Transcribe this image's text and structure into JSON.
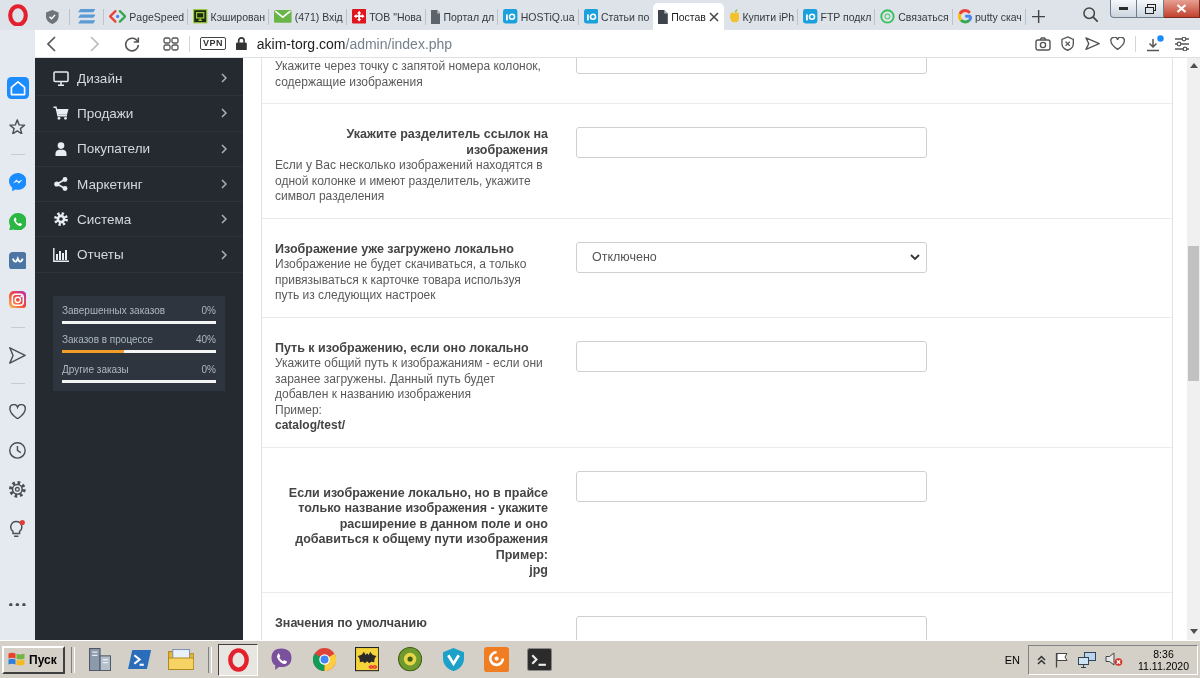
{
  "browser": {
    "tabs": [
      {
        "kind": "pinned",
        "selected": false
      },
      {
        "kind": "pinned",
        "selected": false
      },
      {
        "kind": "page",
        "title": "PageSpeed",
        "selected": false
      },
      {
        "kind": "page",
        "title": "Кэширован",
        "selected": false
      },
      {
        "kind": "page",
        "title": "(471) Вхід",
        "selected": false
      },
      {
        "kind": "page",
        "title": "ТОВ \"Нова",
        "selected": false
      },
      {
        "kind": "page",
        "title": "Портал дл",
        "selected": false
      },
      {
        "kind": "page",
        "title": "HOSTiQ.ua",
        "selected": false
      },
      {
        "kind": "page",
        "title": "Статьи по",
        "selected": false
      },
      {
        "kind": "page",
        "title": "Постав",
        "selected": true
      },
      {
        "kind": "page",
        "title": "Купити iPh",
        "selected": false
      },
      {
        "kind": "page",
        "title": "FTP подкл",
        "selected": false
      },
      {
        "kind": "page",
        "title": "Связаться",
        "selected": false
      },
      {
        "kind": "page",
        "title": "putty скач",
        "selected": false
      }
    ],
    "vpn_badge": "VPN",
    "address": {
      "host": "akim-torg.com",
      "path": "/admin/index.php"
    }
  },
  "opera_sidebar": {
    "items": [
      {
        "kind": "button",
        "selected": true
      },
      {
        "kind": "button",
        "selected": false
      },
      {
        "kind": "divider"
      },
      {
        "kind": "button",
        "selected": false
      },
      {
        "kind": "button",
        "selected": false
      },
      {
        "kind": "button",
        "selected": false
      },
      {
        "kind": "button",
        "selected": false
      },
      {
        "kind": "divider"
      },
      {
        "kind": "button",
        "selected": false
      },
      {
        "kind": "divider"
      },
      {
        "kind": "button",
        "selected": false
      },
      {
        "kind": "button",
        "selected": false
      },
      {
        "kind": "button",
        "selected": false
      },
      {
        "kind": "button",
        "selected": false
      }
    ]
  },
  "admin_menu": {
    "items": [
      {
        "label": "Дизайн"
      },
      {
        "label": "Продажи"
      },
      {
        "label": "Покупатели"
      },
      {
        "label": "Маркетинг"
      },
      {
        "label": "Система"
      },
      {
        "label": "Отчеты"
      }
    ]
  },
  "order_stats": {
    "rows": [
      {
        "label": "Завершенных заказов",
        "reading": "0%"
      },
      {
        "label": "Заказов в процессе",
        "reading": "40%",
        "level": 0.4
      },
      {
        "label": "Другие заказы",
        "reading": "0%"
      }
    ]
  },
  "form": {
    "rows": [
      {
        "kind": "left",
        "description": "Укажите через точку с запятой номера колонок, содержащие изображения",
        "control": {
          "kind": "input"
        }
      },
      {
        "kind": "right",
        "label": "Укажите разделитель ссылок на изображения",
        "description": "Если у Вас несколько изображений находятся в одной колонке и имеют разделитель, укажите символ разделения",
        "control": {
          "kind": "input"
        }
      },
      {
        "kind": "left",
        "label": "Изображение уже загружено локально",
        "description": "Изображение не будет скачиваться, а только привязываться к карточке товара используя путь из следующих настроек",
        "control": {
          "kind": "select",
          "value": "Отключено"
        }
      },
      {
        "kind": "left",
        "label": "Путь к изображению, если оно локально",
        "description": "Укажите общий путь к изображаниям - если они заранее загружены. Данный путь будет добавлен к названию изображения",
        "example_label": "Пример:",
        "example": "catalog/test/",
        "control": {
          "kind": "input"
        }
      },
      {
        "kind": "right-block",
        "label": "Если изображение локально, но в прайсе только название изображения - укажите расширение в данном поле и оно добавиться к общему пути изображения",
        "example_label": "Пример:",
        "example": "jpg",
        "control": {
          "kind": "input"
        }
      },
      {
        "kind": "left",
        "label": "Значения по умолчанию",
        "control": {
          "kind": "input"
        }
      }
    ]
  },
  "taskbar": {
    "start_button": "Пуск",
    "apps": [
      {
        "selected": true
      },
      {
        "selected": false
      },
      {
        "selected": false
      },
      {
        "selected": false
      },
      {
        "selected": false
      },
      {
        "selected": false
      },
      {
        "selected": false
      },
      {
        "selected": false
      }
    ],
    "language": "EN",
    "time": "8:36",
    "date": "11.11.2020"
  }
}
